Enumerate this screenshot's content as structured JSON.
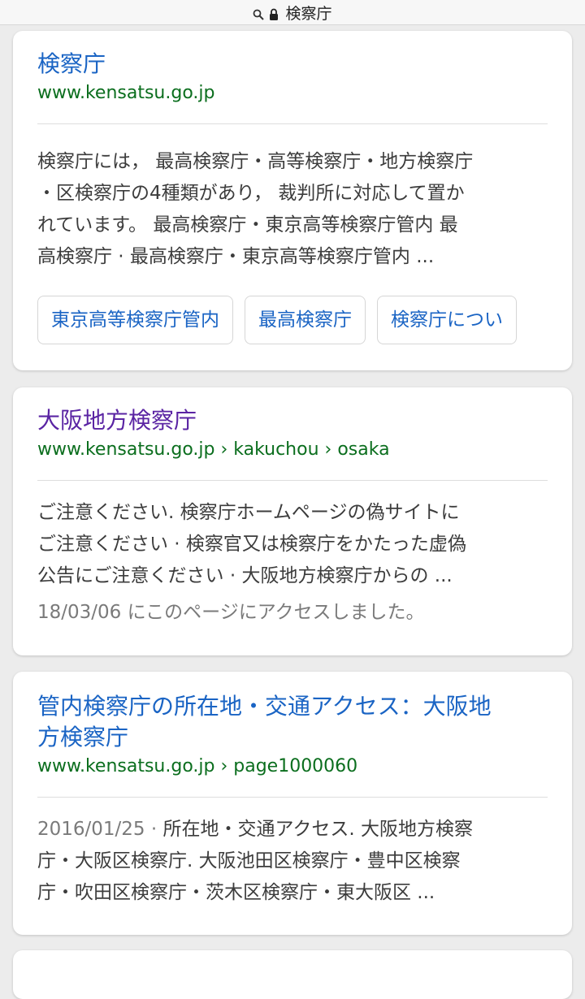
{
  "topbar": {
    "title": "検察庁",
    "search_icon": "search-icon",
    "lock_icon": "lock-icon"
  },
  "results": [
    {
      "title": "検察庁",
      "url": "www.kensatsu.go.jp",
      "snippet_lines": [
        "検察庁には， 最高検察庁・高等検察庁・地方検察庁",
        "・区検察庁の4種類があり， 裁判所に対応して置か",
        "れています。 最高検察庁・東京高等検察庁管内 最",
        "高検察庁 · 最高検察庁・東京高等検察庁管内 ..."
      ],
      "chips": [
        "東京高等検察庁管内",
        "最高検察庁",
        "検察庁につい"
      ]
    },
    {
      "title": "大阪地方検察庁",
      "url": "www.kensatsu.go.jp › kakuchou › osaka",
      "snippet_lines": [
        "ご注意ください. 検察庁ホームページの偽サイトに",
        "ご注意ください · 検察官又は検察庁をかたった虚偽",
        "公告にご注意ください · 大阪地方検察庁からの ..."
      ],
      "accessed": "18/03/06 にこのページにアクセスしました。"
    },
    {
      "title_lines": [
        "管内検察庁の所在地・交通アクセス：大阪地",
        "方検察庁"
      ],
      "url": "www.kensatsu.go.jp › page1000060",
      "snippet_date": "2016/01/25 · ",
      "snippet_lines": [
        "所在地・交通アクセス. 大阪地方検察",
        "庁・大阪区検察庁. 大阪池田区検察庁・豊中区検察",
        "庁・吹田区検察庁・茨木区検察庁・東大阪区 ..."
      ]
    }
  ],
  "colors": {
    "link": "#1a64c4",
    "visited": "#5a24a3",
    "url": "#0b6e1e"
  }
}
